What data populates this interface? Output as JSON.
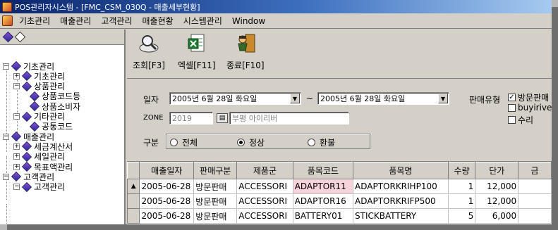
{
  "window": {
    "title": "POS관리자시스템 - [FMC_CSM_030Q - 매출세부현황]"
  },
  "menu": [
    "기초관리",
    "매출관리",
    "고객관리",
    "매출현황",
    "시스템관리",
    "Window"
  ],
  "tree": [
    {
      "label": "기초관리",
      "level": 0,
      "expander": "minus"
    },
    {
      "label": "기초관리",
      "level": 1,
      "expander": "plus"
    },
    {
      "label": "상품관리",
      "level": 1,
      "expander": "minus"
    },
    {
      "label": "상품코드등",
      "level": 2,
      "expander": ""
    },
    {
      "label": "상품소비자",
      "level": 2,
      "expander": ""
    },
    {
      "label": "기타관리",
      "level": 1,
      "expander": "minus"
    },
    {
      "label": "공통코드",
      "level": 2,
      "expander": ""
    },
    {
      "label": "매출관리",
      "level": 0,
      "expander": "minus"
    },
    {
      "label": "세금계산서",
      "level": 1,
      "expander": "plus"
    },
    {
      "label": "세일관리",
      "level": 1,
      "expander": "plus"
    },
    {
      "label": "목표액관리",
      "level": 1,
      "expander": "plus"
    },
    {
      "label": "고객관리",
      "level": 0,
      "expander": "minus"
    },
    {
      "label": "고객관리",
      "level": 1,
      "expander": "minus"
    }
  ],
  "toolbar": {
    "query": "조회[F3]",
    "excel": "엑셀[F11]",
    "exit": "종료[F10]"
  },
  "form": {
    "date_label": "일자",
    "date_from": "2005년  6월 28일 화요일",
    "date_sep": "~",
    "date_to": "2005년  6월 28일 화요일",
    "sale_type_label": "판매유형",
    "sale_types": [
      {
        "label": "방문판매",
        "checked": true
      },
      {
        "label": "buyiriver",
        "checked": false
      },
      {
        "label": "수리",
        "checked": false
      }
    ],
    "zone_label": "ZONE",
    "zone_code": "2019",
    "zone_name": "부평 아이리버",
    "category_label": "구분",
    "category_options": [
      {
        "label": "전체",
        "selected": false
      },
      {
        "label": "정상",
        "selected": true
      },
      {
        "label": "환불",
        "selected": false
      }
    ]
  },
  "grid": {
    "columns": [
      "매출일자",
      "판매구분",
      "제품군",
      "품목코드",
      "품목명",
      "수량",
      "단가",
      "금"
    ],
    "rows": [
      [
        "2005-06-28",
        "방문판매",
        "ACCESSORI",
        "ADAPTOR11",
        "ADAPTORKRIHP100",
        "1",
        "12,000",
        ""
      ],
      [
        "2005-06-28",
        "방문판매",
        "ACCESSORI",
        "ADAPTOR16",
        "ADAPTORKRIFP500",
        "1",
        "12,000",
        ""
      ],
      [
        "2005-06-28",
        "방문판매",
        "ACCESSORI",
        "BATTERY01",
        "STICKBATTERY",
        "5",
        "6,000",
        ""
      ]
    ]
  }
}
